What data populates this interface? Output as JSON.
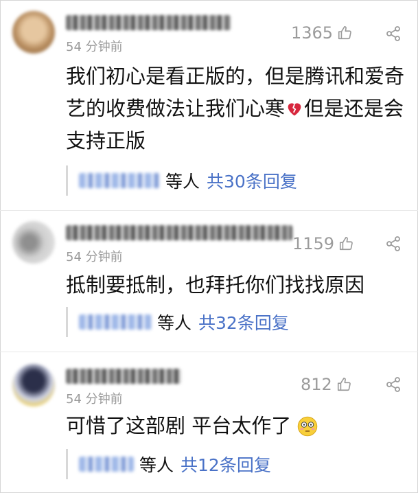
{
  "comments": [
    {
      "time": "54 分钟前",
      "likes": "1365",
      "text": "我们初心是看正版的，但是腾讯和爱奇艺的收费做法让我们心寒",
      "text_tail": "但是还是会支持正版",
      "reply_by": "等人",
      "reply_count": "共30条回复",
      "emoji": "broken-heart-icon"
    },
    {
      "time": "54 分钟前",
      "likes": "1159",
      "text": "抵制要抵制，也拜托你们找找原因",
      "reply_by": "等人",
      "reply_count": "共32条回复"
    },
    {
      "time": "54 分钟前",
      "likes": "812",
      "text": "可惜了这部剧 平台太作了",
      "reply_by": "等人",
      "reply_count": "共12条回复",
      "emoji": "flushed-face-icon"
    }
  ],
  "colors": {
    "reply_link": "#4a72c7",
    "meta_gray": "#9a9a9a"
  }
}
